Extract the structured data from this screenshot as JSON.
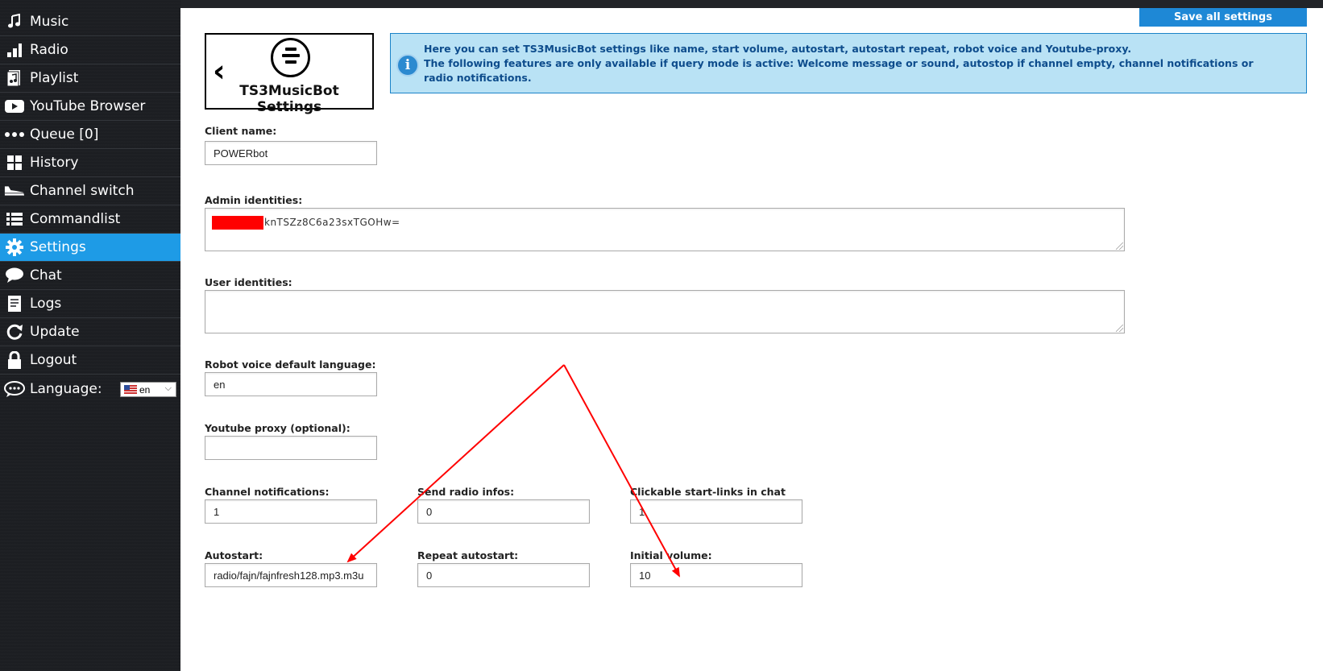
{
  "sidebar": {
    "items": [
      {
        "label": "Music",
        "icon": "music-note-icon"
      },
      {
        "label": "Radio",
        "icon": "signal-bars-icon"
      },
      {
        "label": "Playlist",
        "icon": "playlist-icon"
      },
      {
        "label": "YouTube Browser",
        "icon": "youtube-icon"
      },
      {
        "label": "Queue [0]",
        "icon": "dots-icon"
      },
      {
        "label": "History",
        "icon": "grid-icon"
      },
      {
        "label": "Channel switch",
        "icon": "sneaker-icon"
      },
      {
        "label": "Commandlist",
        "icon": "list-icon"
      },
      {
        "label": "Settings",
        "icon": "gear-icon",
        "active": true
      },
      {
        "label": "Chat",
        "icon": "chat-bubble-icon"
      },
      {
        "label": "Logs",
        "icon": "document-icon"
      },
      {
        "label": "Update",
        "icon": "refresh-icon"
      },
      {
        "label": "Logout",
        "icon": "lock-icon"
      },
      {
        "label": "Language:",
        "icon": "language-bubble-icon"
      }
    ],
    "language_select": {
      "value": "en",
      "flag": "us-flag-icon"
    },
    "active_color": "#1e9be6"
  },
  "header": {
    "save_label": "Save all settings",
    "logo_title": "TS3MusicBot Settings"
  },
  "info": {
    "line1": "Here you can set TS3MusicBot settings like name, start volume, autostart, autostart repeat, robot voice and Youtube-proxy.",
    "line2": "The following features are only available if query mode is active: Welcome message or sound, autostop if channel empty, channel notifications or radio notifications."
  },
  "form": {
    "client_name": {
      "label": "Client name:",
      "value": "POWERbot"
    },
    "admin_identities": {
      "label": "Admin identities:",
      "value": "knTSZz8C6a23sxTGOHw="
    },
    "user_identities": {
      "label": "User identities:",
      "value": ""
    },
    "robot_voice": {
      "label": "Robot voice default language:",
      "value": "en"
    },
    "youtube_proxy": {
      "label": "Youtube proxy (optional):",
      "value": ""
    },
    "channel_notifications": {
      "label": "Channel notifications:",
      "value": "1"
    },
    "send_radio_infos": {
      "label": "Send radio infos:",
      "value": "0"
    },
    "clickable_links": {
      "label": "Clickable start-links in chat",
      "value": "1"
    },
    "autostart": {
      "label": "Autostart:",
      "value": "radio/fajn/fajnfresh128.mp3.m3u"
    },
    "repeat_autostart": {
      "label": "Repeat autostart:",
      "value": "0"
    },
    "initial_volume": {
      "label": "Initial volume:",
      "value": "10"
    }
  },
  "annotation": {
    "arrow_color": "#ff0000"
  }
}
